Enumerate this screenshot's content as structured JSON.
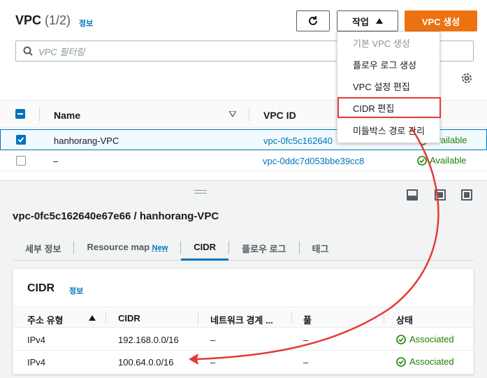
{
  "header": {
    "title": "VPC",
    "count": "(1/2)",
    "info": "정보",
    "actions_label": "작업",
    "create_label": "VPC 생성"
  },
  "search": {
    "placeholder": "VPC 필터링"
  },
  "table": {
    "col_name": "Name",
    "col_vpcid": "VPC ID",
    "rows": [
      {
        "name": "hanhorang-VPC",
        "vpc_id": "vpc-0fc5c162640",
        "state": "Available",
        "selected": true
      },
      {
        "name": "–",
        "vpc_id": "vpc-0ddc7d053bbe39cc8",
        "state": "Available",
        "selected": false
      }
    ]
  },
  "actions_menu": {
    "items": [
      {
        "label": "기본 VPC 생성",
        "disabled": true
      },
      {
        "label": "플로우 로그 생성"
      },
      {
        "label": "VPC 설정 편집"
      },
      {
        "label": "CIDR 편집",
        "highlighted": true
      },
      {
        "label": "미들박스 경로 관리"
      }
    ]
  },
  "detail": {
    "title": "vpc-0fc5c162640e67e66 / hanhorang-VPC",
    "tabs": [
      "세부 정보",
      "Resource map",
      "CIDR",
      "플로우 로그",
      "태그"
    ],
    "new_badge": "New",
    "active_tab": "CIDR"
  },
  "cidr_panel": {
    "title": "CIDR",
    "info": "정보",
    "columns": [
      "주소 유형",
      "CIDR",
      "네트워크 경계 ...",
      "풀",
      "상태"
    ],
    "rows": [
      {
        "type": "IPv4",
        "cidr": "192.168.0.0/16",
        "border": "–",
        "pool": "–",
        "status": "Associated"
      },
      {
        "type": "IPv4",
        "cidr": "100.64.0.0/16",
        "border": "–",
        "pool": "–",
        "status": "Associated"
      }
    ]
  },
  "colors": {
    "accent": "#0073bb",
    "primary_button": "#ec7211",
    "success": "#1d8102",
    "annotation": "#e53935"
  }
}
